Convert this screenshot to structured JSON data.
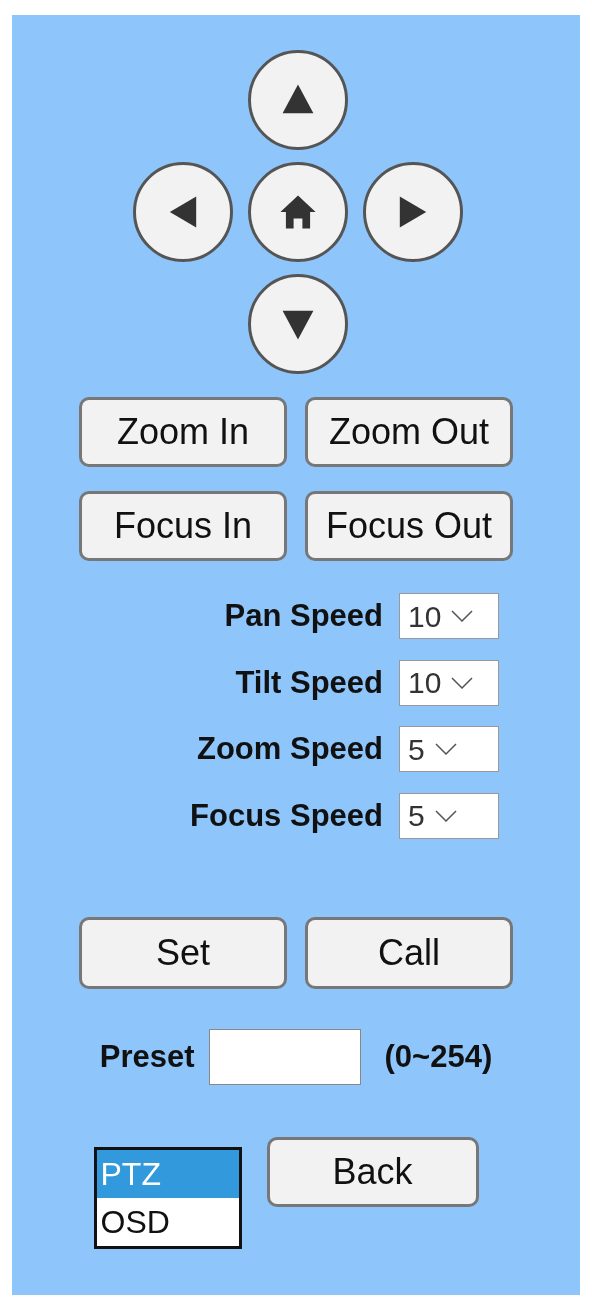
{
  "direction_pad": [
    {
      "kind": "up"
    },
    {
      "kind": "left"
    },
    {
      "kind": "home"
    },
    {
      "kind": "right"
    },
    {
      "kind": "down"
    }
  ],
  "lens_buttons": [
    [
      "Zoom In",
      "Zoom Out"
    ],
    [
      "Focus In",
      "Focus Out"
    ]
  ],
  "speeds": [
    {
      "label": "Pan Speed",
      "value": "10"
    },
    {
      "label": "Tilt Speed",
      "value": "10"
    },
    {
      "label": "Zoom Speed",
      "value": "5"
    },
    {
      "label": "Focus Speed",
      "value": "5"
    }
  ],
  "preset_buttons": [
    "Set",
    "Call"
  ],
  "preset": {
    "label": "Preset",
    "range": "(0~254)"
  },
  "mode_list": [
    {
      "label": "PTZ",
      "selected": true
    },
    {
      "label": "OSD",
      "selected": false
    }
  ],
  "back_button": "Back"
}
